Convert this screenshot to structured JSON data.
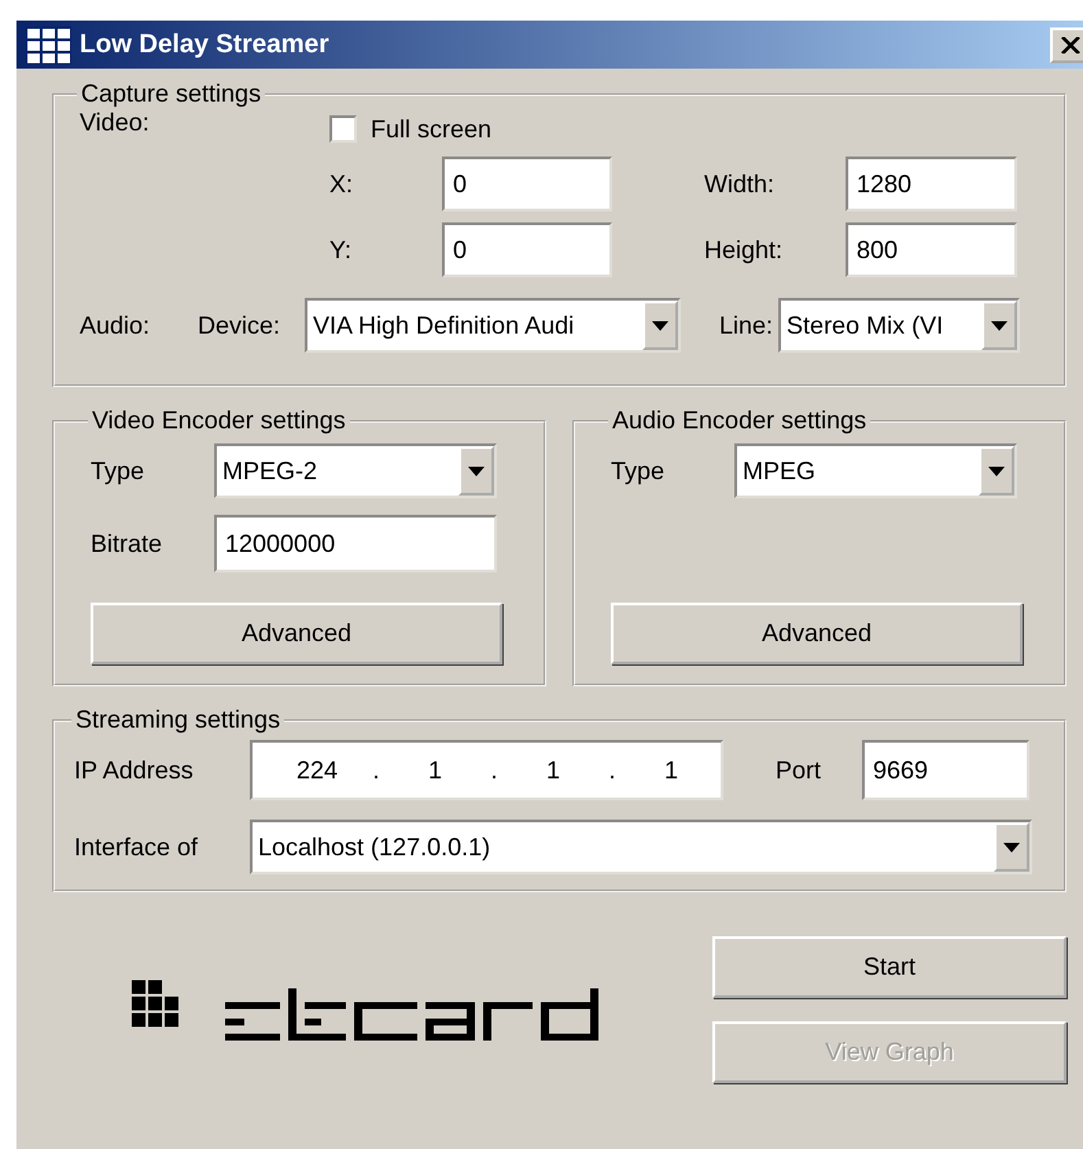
{
  "window": {
    "title": "Low Delay Streamer"
  },
  "capture": {
    "title": "Capture settings",
    "video_label": "Video:",
    "full_screen": {
      "label": "Full screen",
      "checked": false
    },
    "fields": [
      {
        "label": "X:",
        "value": "0"
      },
      {
        "label": "Width:",
        "value": "1280"
      },
      {
        "label": "Y:",
        "value": "0"
      },
      {
        "label": "Height:",
        "value": "800"
      }
    ],
    "audio_label": "Audio:",
    "device": {
      "label": "Device:",
      "value": "VIA High Definition Audi"
    },
    "line": {
      "label": "Line:",
      "value": "Stereo Mix (VI"
    }
  },
  "video_encoder": {
    "title": "Video Encoder settings",
    "type": {
      "label": "Type",
      "value": "MPEG-2"
    },
    "bitrate": {
      "label": "Bitrate",
      "value": "12000000"
    },
    "advanced": "Advanced"
  },
  "audio_encoder": {
    "title": "Audio Encoder settings",
    "type": {
      "label": "Type",
      "value": "MPEG"
    },
    "advanced": "Advanced"
  },
  "streaming": {
    "title": "Streaming settings",
    "ip": {
      "label": "IP Address",
      "parts": [
        "224",
        ".",
        "1",
        ".",
        "1",
        ".",
        "1"
      ]
    },
    "port": {
      "label": "Port",
      "value": "9669"
    },
    "interface": {
      "label": "Interface of",
      "value": "Localhost (127.0.0.1)"
    }
  },
  "buttons": [
    {
      "label": "Start",
      "disabled": false
    },
    {
      "label": "View Graph",
      "disabled": true
    }
  ]
}
